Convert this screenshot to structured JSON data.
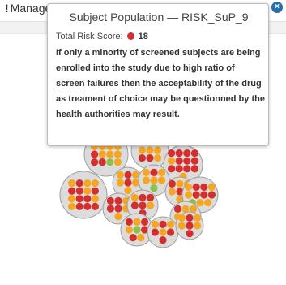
{
  "header": {
    "title": "Manage Critical Processes and Data",
    "warning_glyph": "!",
    "close_glyph": "×"
  },
  "tooltip": {
    "title": "Subject Population — RISK_SuP_9",
    "score_label": "Total Risk Score:",
    "score_value": "18",
    "description": "If only a minority of screened subjects are being enrolled into the study due to high ratio of screen failures then the acceptability of the drug as treament of choice may be questionned by the health authorities may result."
  },
  "colors": {
    "high": "#d32f2f",
    "medium": "#f5a623",
    "low": "#8bc34a",
    "cluster_fill": "#dcdcdc",
    "cluster_stroke": "#9e9e9e"
  },
  "clusters": [
    {
      "id": "c1",
      "dots": [
        "medium",
        "medium",
        "medium",
        "medium",
        "high",
        "medium",
        "medium",
        "medium",
        "high",
        "high",
        "low",
        "medium"
      ]
    },
    {
      "id": "c2",
      "dots": [
        "medium",
        "high",
        "medium",
        "medium",
        "medium",
        "medium",
        "high",
        "high",
        "medium"
      ]
    },
    {
      "id": "c3",
      "dots": [
        "high",
        "high",
        "high",
        "high",
        "medium",
        "high",
        "high",
        "high",
        "high",
        "high",
        "high",
        "high",
        "medium"
      ]
    },
    {
      "id": "c4",
      "dots": [
        "medium",
        "high",
        "medium",
        "medium",
        "high",
        "medium",
        "medium"
      ]
    },
    {
      "id": "c5",
      "dots": [
        "medium",
        "high",
        "medium",
        "medium",
        "medium",
        "medium",
        "low"
      ]
    },
    {
      "id": "c6",
      "dots": [
        "high",
        "medium",
        "medium",
        "medium",
        "high",
        "high",
        "medium"
      ]
    },
    {
      "id": "c7",
      "dots": [
        "medium",
        "high",
        "medium",
        "medium",
        "high",
        "high",
        "medium",
        "high",
        "medium",
        "high",
        "high",
        "medium",
        "medium",
        "high",
        "high",
        "high"
      ]
    },
    {
      "id": "c8",
      "dots": [
        "medium",
        "high",
        "high",
        "medium",
        "medium",
        "high",
        "high",
        "high",
        "low",
        "medium",
        "medium"
      ]
    },
    {
      "id": "c9",
      "dots": [
        "high",
        "high",
        "medium",
        "high",
        "high",
        "medium",
        "medium"
      ]
    },
    {
      "id": "c10",
      "dots": [
        "medium",
        "high",
        "high",
        "high",
        "high",
        "medium",
        "high"
      ]
    },
    {
      "id": "c11",
      "dots": [
        "high",
        "medium",
        "medium",
        "medium",
        "high",
        "high",
        "medium"
      ]
    },
    {
      "id": "c12",
      "dots": [
        "high",
        "medium",
        "high",
        "medium",
        "low",
        "high",
        "high",
        "medium"
      ]
    },
    {
      "id": "c13",
      "dots": [
        "medium",
        "high",
        "medium",
        "high",
        "medium",
        "high",
        "high"
      ]
    },
    {
      "id": "c14",
      "dots": [
        "medium",
        "high",
        "medium",
        "medium",
        "high",
        "medium",
        "high"
      ]
    }
  ]
}
